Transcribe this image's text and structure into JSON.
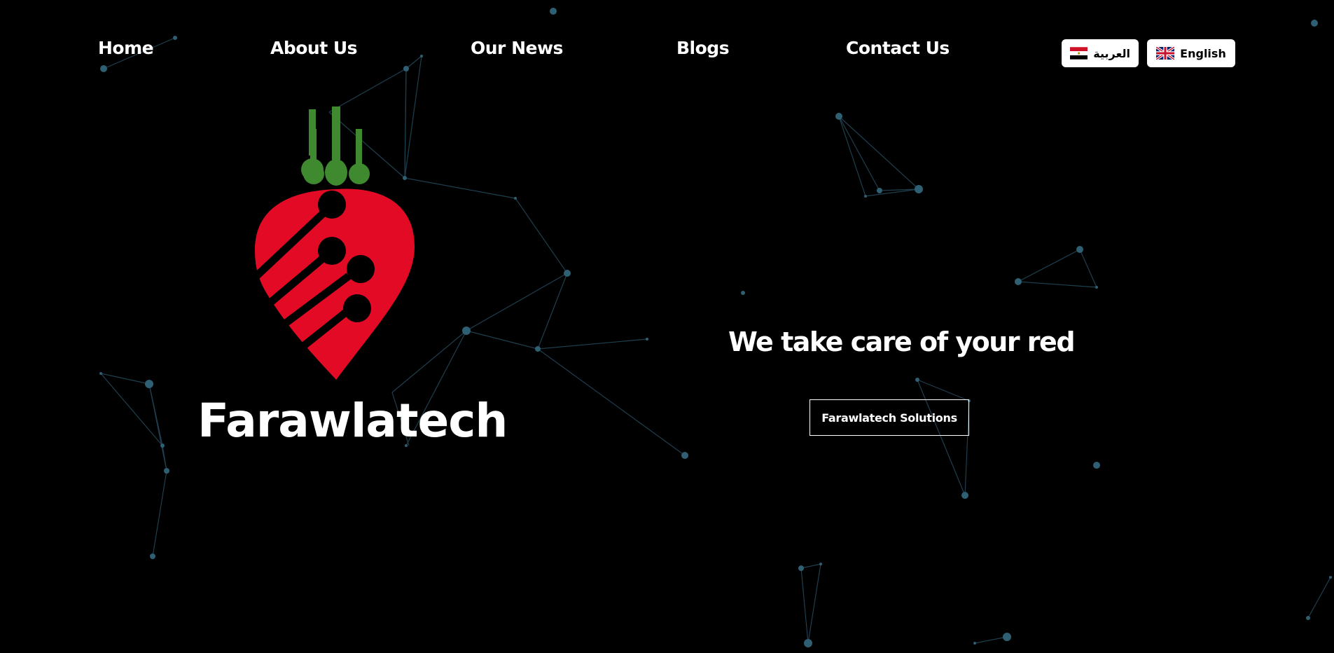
{
  "nav": {
    "items": [
      {
        "label": "Home"
      },
      {
        "label": "About Us"
      },
      {
        "label": "Our News"
      },
      {
        "label": "Blogs"
      },
      {
        "label": "Contact Us"
      }
    ]
  },
  "languages": {
    "arabic": {
      "label": "العربية",
      "flag_icon": "egypt-flag-icon"
    },
    "english": {
      "label": "English",
      "flag_icon": "uk-flag-icon"
    }
  },
  "hero": {
    "brand_name": "Farawlatech",
    "tagline": "We take care of your red",
    "cta_label": "Farawlatech Solutions"
  },
  "colors": {
    "background": "#000000",
    "text": "#ffffff",
    "logo_red": "#e30a25",
    "logo_green": "#3f8a2f",
    "network_line": "#1f3f4e",
    "network_node": "#2e5f73"
  }
}
